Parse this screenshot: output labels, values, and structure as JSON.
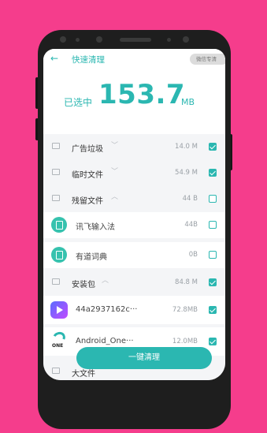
{
  "header": {
    "back_icon": "arrow-left-icon",
    "title": "快速清理",
    "badge": "微信专清"
  },
  "summary": {
    "label": "已选中",
    "size": "153.7",
    "unit": "MB"
  },
  "rows": [
    {
      "kind": "category",
      "label": "广告垃圾",
      "size": "14.0 M",
      "checked": true,
      "icon": "ad-icon",
      "chevron": "chevron-down-icon"
    },
    {
      "kind": "category",
      "label": "临时文件",
      "size": "54.9 M",
      "checked": true,
      "icon": "temp-file-icon",
      "chevron": "chevron-down-icon"
    },
    {
      "kind": "category",
      "label": "残留文件",
      "size": "44 B",
      "checked": false,
      "icon": "residual-file-icon",
      "chevron": "chevron-up-icon"
    },
    {
      "kind": "item",
      "label": "讯飞输入法",
      "size": "44B",
      "checked": false,
      "icon": "file-circle-icon"
    },
    {
      "kind": "item",
      "label": "有道词典",
      "size": "0B",
      "checked": false,
      "icon": "file-circle-icon"
    },
    {
      "kind": "category",
      "label": "安装包",
      "size": "84.8 M",
      "checked": true,
      "icon": "package-icon",
      "chevron": "chevron-up-icon"
    },
    {
      "kind": "item",
      "label": "44a2937162c···",
      "size": "72.8MB",
      "checked": true,
      "icon": "video-app-icon"
    },
    {
      "kind": "item",
      "label": "Android_One···",
      "size": "12.0MB",
      "checked": true,
      "icon": "one-app-icon"
    },
    {
      "kind": "category",
      "label": "大文件",
      "size": "",
      "checked": false,
      "icon": "large-file-icon"
    }
  ],
  "clean_button": "一键清理",
  "colors": {
    "accent": "#2bb7b1",
    "background": "#f53d8c"
  }
}
